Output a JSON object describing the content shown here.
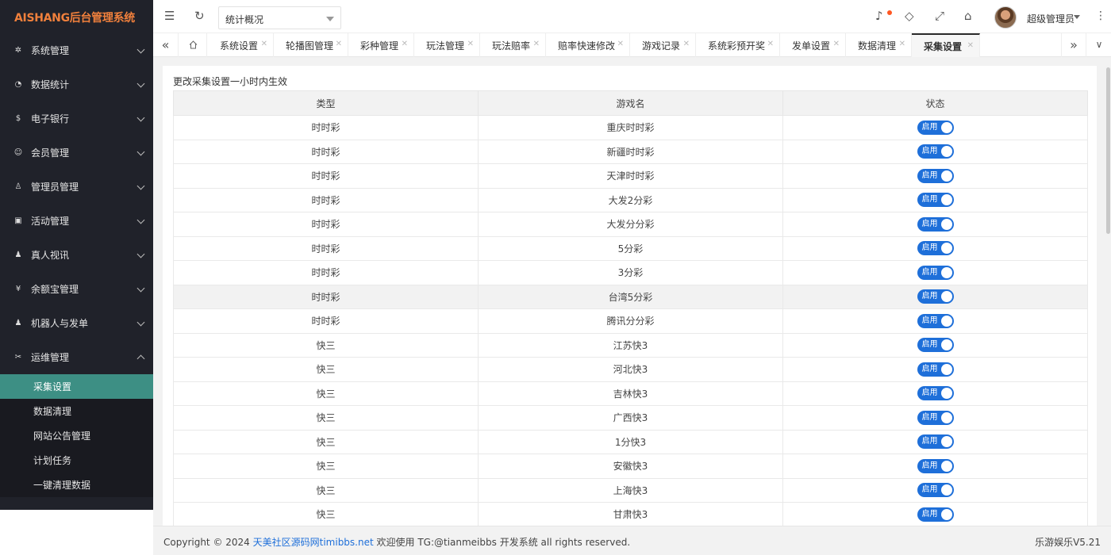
{
  "app": {
    "logo": "AISHANG后台管理系统"
  },
  "sidebar": {
    "items": [
      {
        "label": "系统管理",
        "icon": "gear-icon"
      },
      {
        "label": "数据统计",
        "icon": "dashboard-icon"
      },
      {
        "label": "电子银行",
        "icon": "dollar-icon"
      },
      {
        "label": "会员管理",
        "icon": "users-icon"
      },
      {
        "label": "管理员管理",
        "icon": "user-icon"
      },
      {
        "label": "活动管理",
        "icon": "gift-icon"
      },
      {
        "label": "真人视讯",
        "icon": "group-icon"
      },
      {
        "label": "余额宝管理",
        "icon": "yen-icon"
      },
      {
        "label": "机器人与发单",
        "icon": "person-icon"
      },
      {
        "label": "运维管理",
        "icon": "tools-icon"
      }
    ],
    "submenu": [
      "采集设置",
      "数据清理",
      "网站公告管理",
      "计划任务",
      "一键清理数据"
    ]
  },
  "header": {
    "select_value": "统计概况",
    "user_name": "超级管理员"
  },
  "tabs": [
    "系统设置",
    "轮播图管理",
    "彩种管理",
    "玩法管理",
    "玩法赔率",
    "赔率快速修改",
    "游戏记录",
    "系统彩预开奖",
    "发单设置",
    "数据清理",
    "采集设置"
  ],
  "main": {
    "notice": "更改采集设置一小时内生效",
    "columns": [
      "类型",
      "游戏名",
      "状态"
    ],
    "switch_label": "启用",
    "rows": [
      {
        "type": "时时彩",
        "name": "重庆时时彩",
        "status": "启用"
      },
      {
        "type": "时时彩",
        "name": "新疆时时彩",
        "status": "启用"
      },
      {
        "type": "时时彩",
        "name": "天津时时彩",
        "status": "启用"
      },
      {
        "type": "时时彩",
        "name": "大发2分彩",
        "status": "启用"
      },
      {
        "type": "时时彩",
        "name": "大发分分彩",
        "status": "启用"
      },
      {
        "type": "时时彩",
        "name": "5分彩",
        "status": "启用"
      },
      {
        "type": "时时彩",
        "name": "3分彩",
        "status": "启用"
      },
      {
        "type": "时时彩",
        "name": "台湾5分彩",
        "status": "启用"
      },
      {
        "type": "时时彩",
        "name": "腾讯分分彩",
        "status": "启用"
      },
      {
        "type": "快三",
        "name": "江苏快3",
        "status": "启用"
      },
      {
        "type": "快三",
        "name": "河北快3",
        "status": "启用"
      },
      {
        "type": "快三",
        "name": "吉林快3",
        "status": "启用"
      },
      {
        "type": "快三",
        "name": "广西快3",
        "status": "启用"
      },
      {
        "type": "快三",
        "name": "1分快3",
        "status": "启用"
      },
      {
        "type": "快三",
        "name": "安徽快3",
        "status": "启用"
      },
      {
        "type": "快三",
        "name": "上海快3",
        "status": "启用"
      },
      {
        "type": "快三",
        "name": "甘肃快3",
        "status": "启用"
      }
    ]
  },
  "footer": {
    "prefix": "Copyright © 2024 ",
    "link": "天美社区源码网timibbs.net",
    "suffix": " 欢迎使用 TG:@tianmeibbs 开发系统 all rights reserved.",
    "version": "乐游娱乐V5.21"
  },
  "colors": {
    "accent": "#3d8f84",
    "switch_on": "#1e6fd9",
    "logo": "#f0803c",
    "sidebar_bg": "#20222a"
  }
}
